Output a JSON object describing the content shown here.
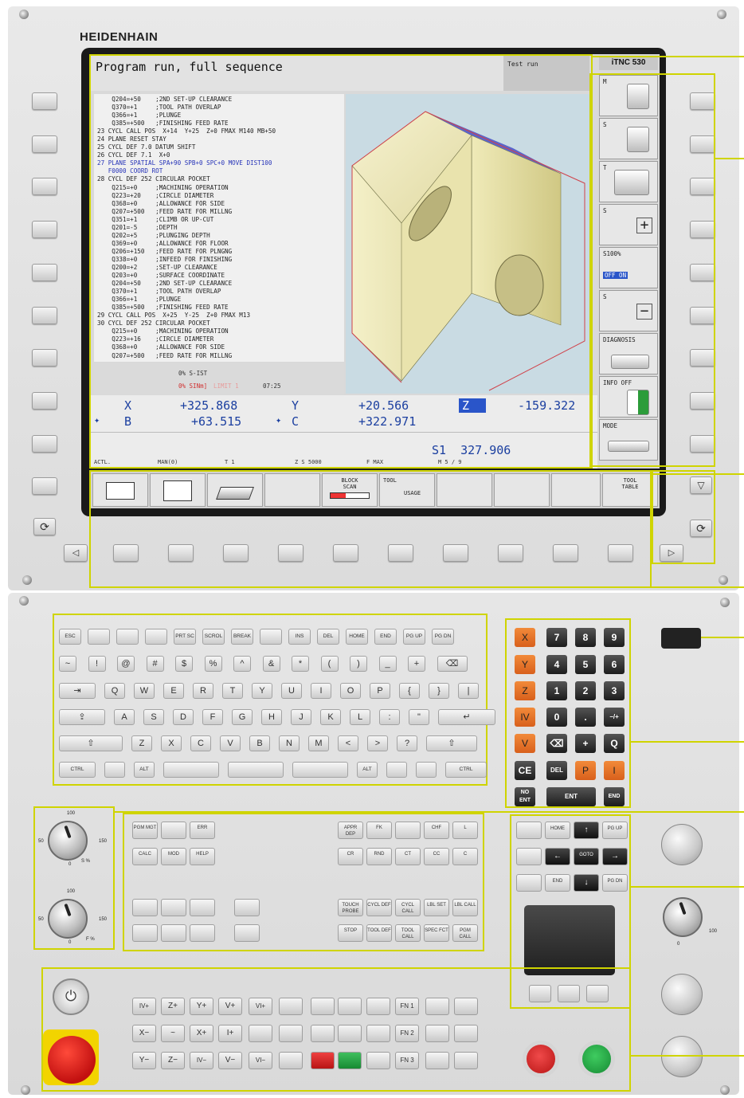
{
  "brand": "HEIDENHAIN",
  "screen": {
    "mode_title": "Program run, full sequence",
    "secondary_mode": "Test run",
    "control_label": "iTNC 530",
    "program_lines": [
      "    Q204=+50    ;2ND SET-UP CLEARANCE",
      "    Q370=+1     ;TOOL PATH OVERLAP",
      "    Q366=+1     ;PLUNGE",
      "    Q385=+500   ;FINISHING FEED RATE",
      "23 CYCL CALL POS  X+14  Y+25  Z+0 FMAX M140 MB+50",
      "24 PLANE RESET STAY",
      "25 CYCL DEF 7.0 DATUM SHIFT",
      "26 CYCL DEF 7.1  X+0",
      "27 PLANE SPATIAL SPA+90 SPB+0 SPC+0 MOVE DIST100",
      "   F0000 COORD ROT",
      "28 CYCL DEF 252 CIRCULAR POCKET",
      "    Q215=+0     ;MACHINING OPERATION",
      "    Q223=+20    ;CIRCLE DIAMETER",
      "    Q368=+0     ;ALLOWANCE FOR SIDE",
      "    Q207=+500   ;FEED RATE FOR MILLNG",
      "    Q351=+1     ;CLIMB OR UP-CUT",
      "    Q201=-5     ;DEPTH",
      "    Q202=+5     ;PLUNGING DEPTH",
      "    Q369=+0     ;ALLOWANCE FOR FLOOR",
      "    Q206=+150   ;FEED RATE FOR PLNGNG",
      "    Q338=+0     ;INFEED FOR FINISHING",
      "    Q200=+2     ;SET-UP CLEARANCE",
      "    Q203=+0     ;SURFACE COORDINATE",
      "    Q204=+50    ;2ND SET-UP CLEARANCE",
      "    Q370=+1     ;TOOL PATH OVERLAP",
      "    Q366=+1     ;PLUNGE",
      "    Q385=+500   ;FINISHING FEED RATE",
      "29 CYCL CALL POS  X+25  Y-25  Z+0 FMAX M13",
      "30 CYCL DEF 252 CIRCULAR POCKET",
      "    Q215=+0     ;MACHINING OPERATION",
      "    Q223=+16    ;CIRCLE DIAMETER",
      "    Q368=+0     ;ALLOWANCE FOR SIDE",
      "    Q207=+500   ;FEED RATE FOR MILLNG"
    ],
    "status": {
      "line1": "0% S-IST",
      "line2a": "0% SINm]",
      "line2b": "LIMIT 1",
      "time": "07:25"
    },
    "positions": {
      "x_label": "X",
      "x_value": "+325.868",
      "y_label": "Y",
      "y_value": "+20.566",
      "z_label": "Z",
      "z_value": "-159.322",
      "b_label": "B",
      "b_value": "+63.515",
      "c_label": "C",
      "c_value": "+322.971",
      "s_label": "S1",
      "s_value": "327.906"
    },
    "bottom_status": [
      "ACTL.",
      "MAN(0)",
      "T 1",
      "Z S 5000",
      "F MAX",
      "M 5 / 9"
    ],
    "side_softkeys": [
      {
        "label": "M",
        "sub": ""
      },
      {
        "label": "S",
        "sub": ""
      },
      {
        "label": "T",
        "sub": ""
      },
      {
        "label": "S",
        "sub": "+"
      },
      {
        "label": "S100%",
        "sub": "OFF     ON"
      },
      {
        "label": "S",
        "sub": "−"
      },
      {
        "label": "DIAGNOSIS",
        "sub": ""
      },
      {
        "label": "INFO   OFF",
        "sub": ""
      },
      {
        "label": "MODE",
        "sub": ""
      }
    ],
    "bottom_softkeys": [
      {
        "line1": "",
        "line2": ""
      },
      {
        "line1": "",
        "line2": ""
      },
      {
        "line1": "",
        "line2": ""
      },
      {
        "line1": "",
        "line2": ""
      },
      {
        "line1": "BLOCK",
        "line2": "SCAN"
      },
      {
        "line1": "TOOL",
        "line2": "USAGE"
      },
      {
        "line1": "",
        "line2": ""
      },
      {
        "line1": "",
        "line2": ""
      },
      {
        "line1": "",
        "line2": ""
      },
      {
        "line1": "TOOL",
        "line2": "TABLE"
      }
    ]
  },
  "keyboard": {
    "row1": [
      "ESC",
      "",
      "",
      "",
      "PRT SC",
      "SCROL",
      "BREAK",
      "",
      "INS",
      "DEL",
      "HOME",
      "END",
      "PG UP",
      "PG DN"
    ],
    "row2": [
      "~",
      "!",
      "@",
      "#",
      "$",
      "%",
      "^",
      "&",
      "*",
      "(",
      ")",
      "_",
      "+",
      "⌫"
    ],
    "row3": [
      "⇥",
      "Q",
      "W",
      "E",
      "R",
      "T",
      "Y",
      "U",
      "I",
      "O",
      "P",
      "{",
      "}",
      "|"
    ],
    "row4": [
      "⇪",
      "A",
      "S",
      "D",
      "F",
      "G",
      "H",
      "J",
      "K",
      "L",
      ":",
      "\"",
      "↵"
    ],
    "row5": [
      "⇧",
      "Z",
      "X",
      "C",
      "V",
      "B",
      "N",
      "M",
      "<",
      ">",
      "?",
      "⇧"
    ],
    "row6": [
      "CTRL",
      "",
      "ALT",
      "",
      "",
      "",
      "ALT",
      "",
      "",
      "CTRL"
    ]
  },
  "numpad": [
    [
      "X",
      "7",
      "8",
      "9"
    ],
    [
      "Y",
      "4",
      "5",
      "6"
    ],
    [
      "Z",
      "1",
      "2",
      "3"
    ],
    [
      "IV",
      "0",
      ".",
      "−/+"
    ],
    [
      "V",
      "⌫",
      "+",
      "Q"
    ],
    [
      "CE",
      "DEL",
      "P",
      "I"
    ],
    [
      "NO ENT",
      "ENT",
      "END"
    ]
  ],
  "function_keys": {
    "left": [
      [
        "PGM MGT",
        "",
        "ERR"
      ],
      [
        "CALC",
        "MOD",
        "HELP"
      ]
    ],
    "middle": [
      [
        "APPR DEP",
        "FK",
        "",
        "CHF",
        "L"
      ],
      [
        "CR",
        "RND",
        "CT",
        "CC",
        "C"
      ]
    ],
    "lower_mid": [
      [
        "TOUCH PROBE",
        "CYCL DEF",
        "CYCL CALL",
        "LBL SET",
        "LBL CALL"
      ],
      [
        "STOP",
        "TOOL DEF",
        "TOOL CALL",
        "SPEC FCT",
        "PGM CALL"
      ]
    ],
    "nav": [
      [
        "",
        "HOME",
        "↑",
        "PG UP"
      ],
      [
        "",
        "←",
        "GOTO",
        "→"
      ],
      [
        "",
        "END",
        "↓",
        "PG DN"
      ]
    ]
  },
  "overrides": {
    "spindle_override": {
      "marks": [
        "100",
        "50",
        "150",
        "0"
      ],
      "label": "S %"
    },
    "feed_override": {
      "marks": [
        "100",
        "50",
        "150",
        "0"
      ],
      "label": "F %"
    },
    "rapid_override": {
      "marks": [
        "0",
        "100"
      ]
    }
  },
  "machine_keys": {
    "row1": [
      "IV+",
      "Z+",
      "Y+",
      "V+",
      "VI+",
      "",
      "",
      "",
      "",
      "FN 1",
      "",
      ""
    ],
    "row2": [
      "X−",
      "~",
      "X+",
      "I+",
      "",
      "",
      "",
      "",
      "",
      "FN 2",
      "",
      ""
    ],
    "row3": [
      "Y−",
      "Z−",
      "IV−",
      "V−",
      "VI−",
      "",
      "",
      "",
      "",
      "FN 3",
      "",
      ""
    ]
  },
  "colors": {
    "highlight": "#cfd400",
    "axis_key": "#e8793a",
    "screen_text": "#1b3fa0",
    "emergency": "#d61b1b",
    "start": "#1f9c3a"
  }
}
